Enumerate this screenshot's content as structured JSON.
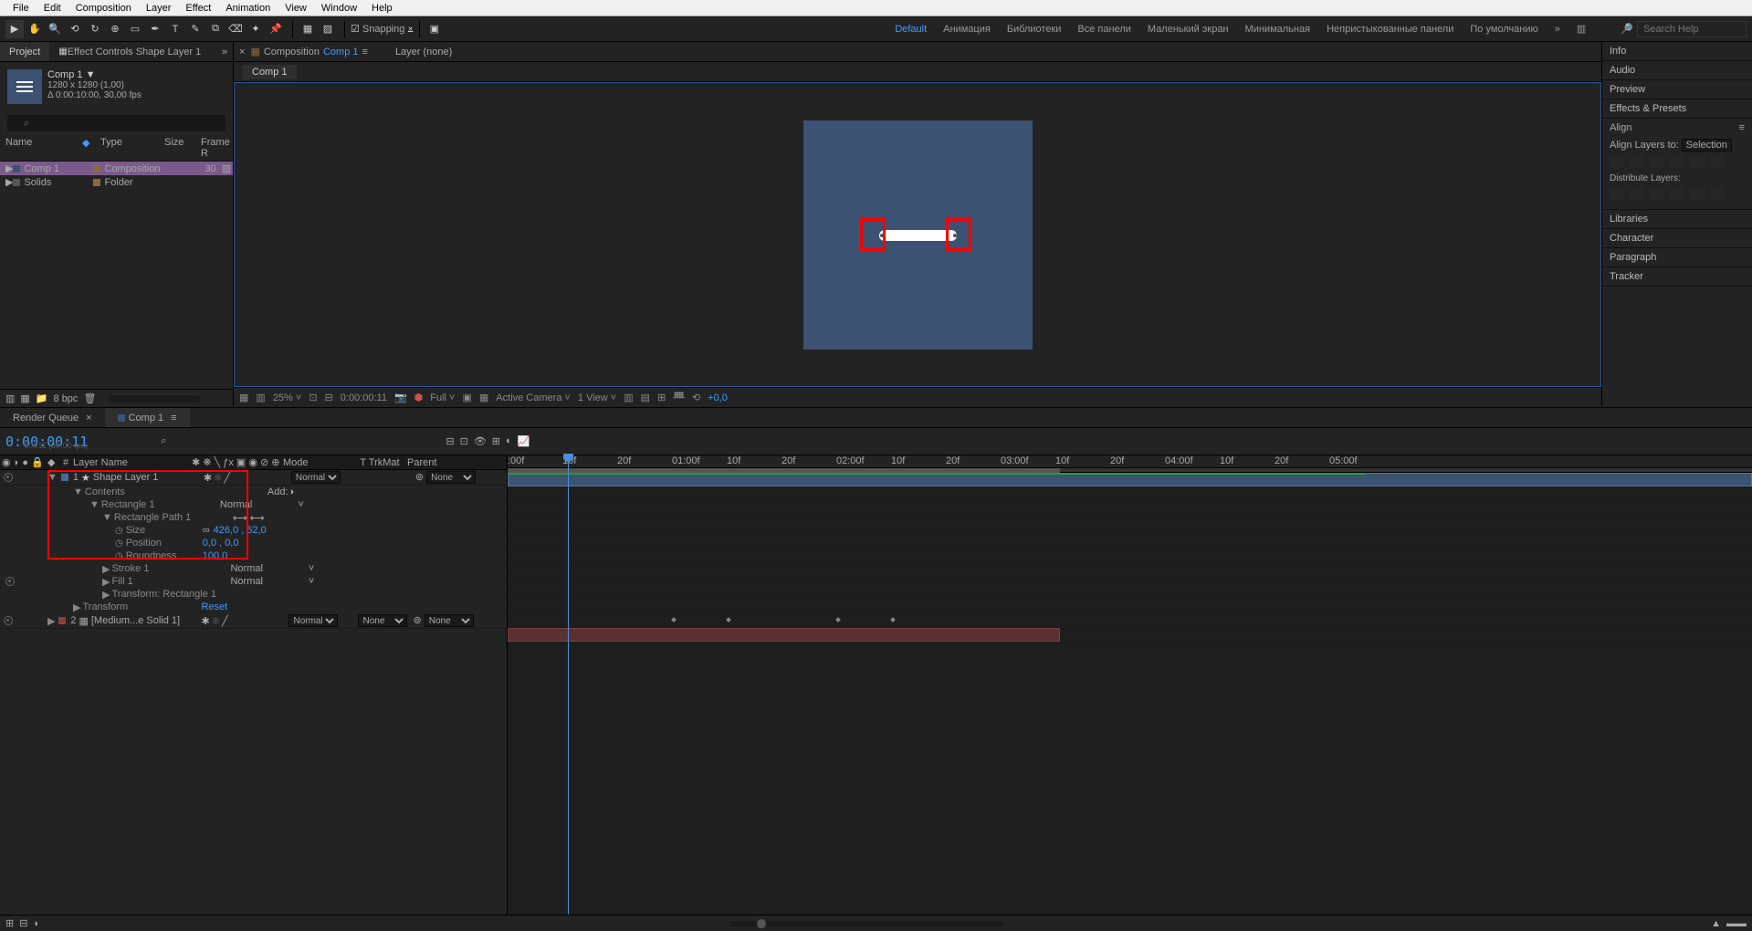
{
  "menu": {
    "items": [
      "File",
      "Edit",
      "Composition",
      "Layer",
      "Effect",
      "Animation",
      "View",
      "Window",
      "Help"
    ]
  },
  "toolbar": {
    "snapping": "Snapping"
  },
  "workspaces": {
    "items": [
      "Default",
      "Анимация",
      "Библиотеки",
      "Все панели",
      "Маленький экран",
      "Минимальная",
      "Непристыкованные панели",
      "По умолчанию"
    ],
    "search_ph": "Search Help"
  },
  "project_panel": {
    "tab1": "Project",
    "tab2": "Effect Controls Shape Layer 1",
    "comp_name": "Comp 1 ▼",
    "comp_dim": "1280 x 1280 (1,00)",
    "comp_dur": "Δ 0:00:10:00, 30,00 fps",
    "cols": {
      "name": "Name",
      "type": "Type",
      "size": "Size",
      "frame": "Frame R"
    },
    "rows": [
      {
        "name": "Comp 1",
        "type": "Composition",
        "fr": "30",
        "sel": true
      },
      {
        "name": "Solids",
        "type": "Folder",
        "fr": "",
        "sel": false
      }
    ],
    "bpc": "8 bpc"
  },
  "comp_panel": {
    "label": "Composition",
    "comp": "Comp 1",
    "layer": "Layer  (none)",
    "tab": "Comp 1"
  },
  "view_controls": {
    "zoom": "25%",
    "tc": "0:00:00:11",
    "res": "Full",
    "cam": "Active Camera",
    "view": "1 View",
    "exp": "+0,0"
  },
  "right_panels": [
    "Info",
    "Audio",
    "Preview",
    "Effects & Presets",
    "Align",
    "Libraries",
    "Character",
    "Paragraph",
    "Tracker"
  ],
  "align_panel": {
    "label": "Align Layers to:",
    "sel": "Selection",
    "dist": "Distribute Layers:"
  },
  "timeline": {
    "tab_rq": "Render Queue",
    "tab_comp": "Comp 1",
    "timecode": "0:00:00:11",
    "tc_sub": "00011 (30.00 fps)",
    "cols": {
      "num": "#",
      "lname": "Layer Name",
      "mode": "Mode",
      "trk": "TrkMat",
      "parent": "Parent"
    },
    "layer1": {
      "num": "1",
      "name": "Shape Layer 1",
      "mode": "Normal",
      "parent": "None"
    },
    "layer2": {
      "num": "2",
      "name": "[Medium...e Solid 1]",
      "mode": "Normal",
      "trk": "None",
      "parent": "None"
    },
    "contents": "Contents",
    "add": "Add:",
    "rect1": "Rectangle 1",
    "rect1_mode": "Normal",
    "rectpath": "Rectangle Path 1",
    "p_size": "Size",
    "p_size_v": "426,0 , 62,0",
    "p_pos": "Position",
    "p_pos_v": "0,0 , 0,0",
    "p_round": "Roundness",
    "p_round_v": "100,0",
    "stroke": "Stroke 1",
    "stroke_m": "Normal",
    "fill": "Fill 1",
    "fill_m": "Normal",
    "tr_rect": "Transform: Rectangle 1",
    "transform": "Transform",
    "reset": "Reset",
    "ruler_marks": [
      ":00f",
      "10f",
      "20f",
      "01:00f",
      "10f",
      "20f",
      "02:00f",
      "10f",
      "20f",
      "03:00f",
      "10f",
      "20f",
      "04:00f",
      "10f",
      "20f",
      "05:00f"
    ]
  }
}
